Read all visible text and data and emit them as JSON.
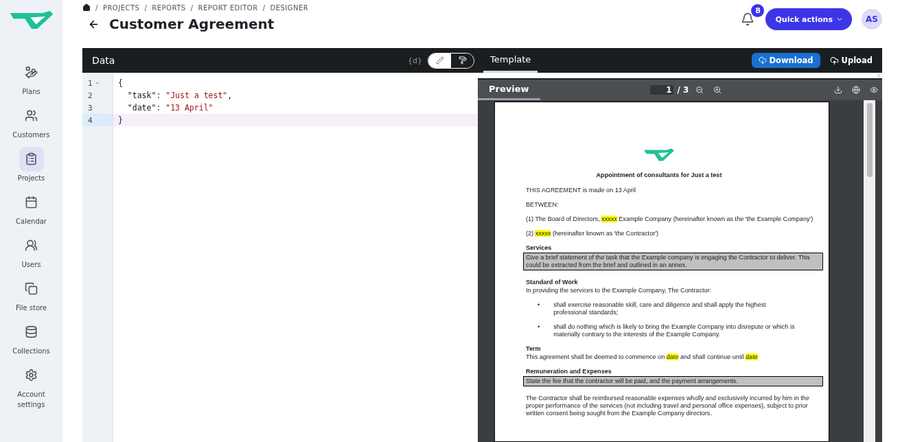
{
  "sidebar": {
    "items": [
      {
        "kind": "plans",
        "label": "Plans",
        "selected": false
      },
      {
        "kind": "customers",
        "label": "Customers",
        "selected": false
      },
      {
        "kind": "projects",
        "label": "Projects",
        "selected": true
      },
      {
        "kind": "calendar",
        "label": "Calendar",
        "selected": false
      },
      {
        "kind": "users",
        "label": "Users",
        "selected": false
      },
      {
        "kind": "files",
        "label": "File store",
        "selected": false
      },
      {
        "kind": "collections",
        "label": "Collections",
        "selected": false
      },
      {
        "kind": "settings",
        "label": "Account settings",
        "selected": false
      }
    ]
  },
  "breadcrumb": [
    "/",
    "PROJECTS",
    "/",
    "REPORTS",
    "/",
    "REPORT EDITOR",
    "/",
    "DESIGNER"
  ],
  "title": "Customer Agreement",
  "header": {
    "notifications": "8",
    "quick_actions": "Quick actions",
    "avatar": "AS"
  },
  "data_panel": {
    "title": "Data",
    "format_label": "{d}",
    "modes": [
      {
        "kind": "edit",
        "selected": true
      },
      {
        "kind": "paint",
        "selected": false
      }
    ],
    "lines": [
      {
        "number": "1",
        "foldable": true,
        "active": false,
        "tokens": [
          {
            "kind": "punct",
            "text": "{"
          }
        ]
      },
      {
        "number": "2",
        "foldable": false,
        "active": false,
        "tokens": [
          {
            "kind": "key",
            "text": "  \"task\""
          },
          {
            "kind": "punct",
            "text": ": "
          },
          {
            "kind": "string",
            "text": "\"Just a test\""
          },
          {
            "kind": "punct",
            "text": ","
          }
        ]
      },
      {
        "number": "3",
        "foldable": false,
        "active": false,
        "tokens": [
          {
            "kind": "key",
            "text": "  \"date\""
          },
          {
            "kind": "punct",
            "text": ": "
          },
          {
            "kind": "string",
            "text": "\"13 April\""
          }
        ]
      },
      {
        "number": "4",
        "foldable": false,
        "active": true,
        "tokens": [
          {
            "kind": "punct",
            "text": "}"
          }
        ]
      }
    ]
  },
  "template_panel": {
    "tabs": [
      {
        "label": "Template",
        "selected": true
      }
    ],
    "download": "Download",
    "upload": "Upload",
    "preview": {
      "title": "Preview",
      "page": "1",
      "page_total": "/ 3",
      "document": [
        {
          "kind": "title",
          "parts": [
            {
              "text": "Appointment of consultants for Just a test",
              "highlight": false
            }
          ]
        },
        {
          "kind": "paragraph",
          "parts": [
            {
              "text": "THIS AGREEMENT is made on 13 April",
              "highlight": false
            }
          ]
        },
        {
          "kind": "paragraph",
          "parts": [
            {
              "text": "BETWEEN:",
              "highlight": false
            }
          ]
        },
        {
          "kind": "paragraph",
          "parts": [
            {
              "text": "(1)  The Board of Directors, ",
              "highlight": false
            },
            {
              "text": "xxxxx",
              "highlight": true
            },
            {
              "text": " Example Company (hereinafter known as the 'the Example Company')",
              "highlight": false
            }
          ]
        },
        {
          "kind": "paragraph",
          "parts": [
            {
              "text": "(2)  ",
              "highlight": false
            },
            {
              "text": "xxxxx",
              "highlight": true
            },
            {
              "text": " (hereinafter known as 'the Contractor')",
              "highlight": false
            }
          ]
        },
        {
          "kind": "heading",
          "parts": [
            {
              "text": "Services",
              "highlight": false
            }
          ]
        },
        {
          "kind": "boxed",
          "parts": [
            {
              "text": "Give a brief statement of the task that the Example company is engaging the Contractor to deliver. This could be extracted from the brief and outlined in an annex.",
              "highlight": false
            }
          ]
        },
        {
          "kind": "heading",
          "parts": [
            {
              "text": "Standard of Work",
              "highlight": false
            }
          ]
        },
        {
          "kind": "paragraph",
          "parts": [
            {
              "text": "In providing the services to the Example Company, The Contractor:",
              "highlight": false
            }
          ]
        },
        {
          "kind": "bullet",
          "marker": "•",
          "parts": [
            {
              "text": "shall exercise reasonable skill, care and diligence and shall apply the highest professional standards;",
              "highlight": false
            }
          ]
        },
        {
          "kind": "bullet",
          "marker": "•",
          "parts": [
            {
              "text": "shall do nothing which is likely to bring the Example Company into disrepute or which is materially contrary to the interests of the Example Company.",
              "highlight": false
            }
          ]
        },
        {
          "kind": "heading",
          "parts": [
            {
              "text": "Term",
              "highlight": false
            }
          ]
        },
        {
          "kind": "paragraph",
          "parts": [
            {
              "text": "This agreement shall be deemed to commence on ",
              "highlight": false
            },
            {
              "text": "date",
              "highlight": true
            },
            {
              "text": " and shall continue until ",
              "highlight": false
            },
            {
              "text": "date",
              "highlight": true
            }
          ]
        },
        {
          "kind": "heading",
          "parts": [
            {
              "text": "Remuneration and Expenses",
              "highlight": false
            }
          ]
        },
        {
          "kind": "boxed",
          "parts": [
            {
              "text": "State the fee that the contractor will be paid, and the payment arrangements.",
              "highlight": false
            }
          ]
        },
        {
          "kind": "paragraph",
          "parts": [
            {
              "text": "The Contractor shall be reimbursed reasonable expenses wholly and exclusively incurred by him in the proper performance of the services (not including travel and personal office expenses), subject to prior written consent being sought from the Example Company directors.",
              "highlight": false
            }
          ]
        }
      ]
    }
  }
}
